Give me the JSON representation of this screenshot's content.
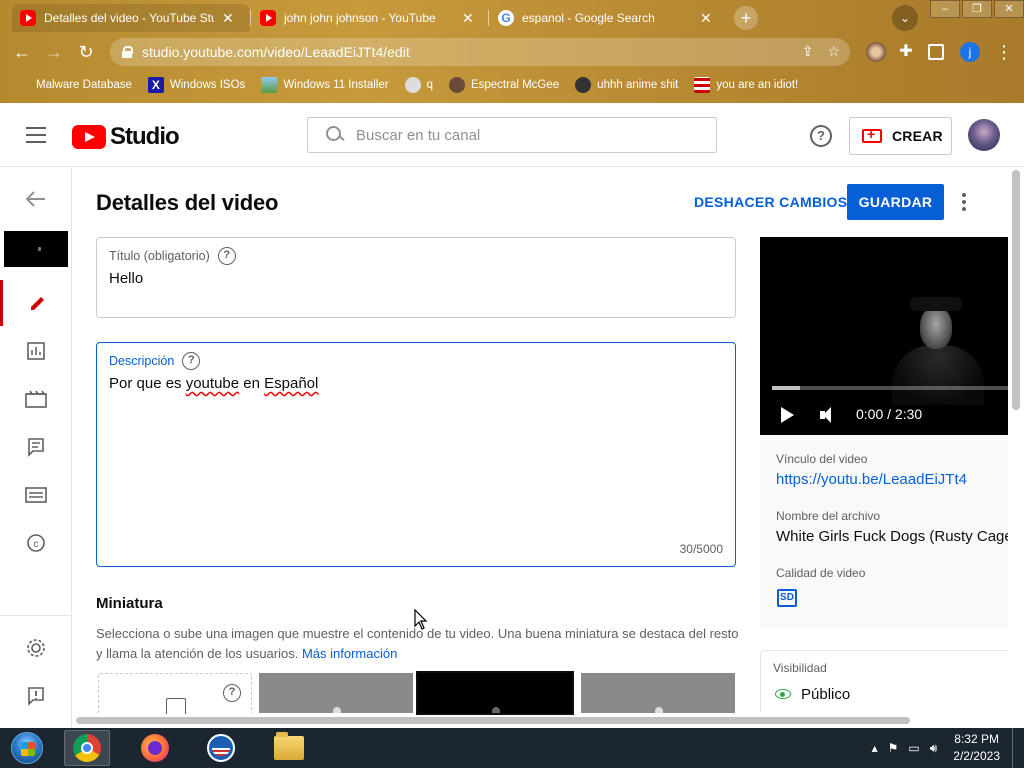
{
  "browser": {
    "tabs": [
      {
        "title": "Detalles del video - YouTube Stu",
        "favicon": "youtube-icon",
        "active": true
      },
      {
        "title": "john john johnson - YouTube",
        "favicon": "youtube-icon",
        "active": false
      },
      {
        "title": "espanol - Google Search",
        "favicon": "google-icon",
        "active": false
      }
    ],
    "tab_close_glyph": "✕",
    "new_tab_glyph": "+",
    "url": "studio.youtube.com/video/LeaadEiJTt4/edit",
    "profile_initial": "j",
    "bookmarks": [
      {
        "label": "Malware Database",
        "icon": "bookmark-icon"
      },
      {
        "label": "Windows ISOs",
        "icon": "x-logo-icon"
      },
      {
        "label": "Windows 11 Installer",
        "icon": "image-icon"
      },
      {
        "label": "q",
        "icon": "face-icon"
      },
      {
        "label": "Espectral McGee",
        "icon": "face-icon"
      },
      {
        "label": "uhhh anime shit",
        "icon": "anime-icon"
      },
      {
        "label": "you are an idiot!",
        "icon": "flag-icon"
      }
    ]
  },
  "header": {
    "logo_text": "Studio",
    "search_placeholder": "Buscar en tu canal",
    "help_glyph": "?",
    "create_label": "CREAR"
  },
  "main": {
    "title": "Detalles del video",
    "undo_label": "DESHACER CAMBIOS",
    "save_label": "GUARDAR",
    "title_field": {
      "label": "Título (obligatorio)",
      "value": "Hello"
    },
    "description_field": {
      "label": "Descripción",
      "value_before": "Por que es ",
      "value_misspelled": "youtube",
      "value_after": " en ",
      "value_misspelled2": "Español",
      "counter": "30/5000"
    },
    "thumbnail": {
      "heading": "Miniatura",
      "description": "Selecciona o sube una imagen que muestre el contenido de tu video. Una buena miniatura se destaca del resto y llama la atención de los usuarios. ",
      "link": "Más información"
    }
  },
  "panel": {
    "time": "0:00 / 2:30",
    "playback_progress": 0.12,
    "link_label": "Vínculo del video",
    "link_value": "https://youtu.be/LeaadEiJTt4",
    "filename_label": "Nombre del archivo",
    "filename_value": "White Girls Fuck Dogs (Rusty Cage",
    "quality_label": "Calidad de video",
    "quality_badge": "SD",
    "visibility_label": "Visibilidad",
    "visibility_value": "Público"
  },
  "taskbar": {
    "time": "8:32 PM",
    "date": "2/2/2023"
  },
  "colors": {
    "accent": "#065fd4",
    "youtube_red": "#ff0000",
    "active_nav": "#cc0000",
    "chrome_theme": "#c79a3c"
  }
}
